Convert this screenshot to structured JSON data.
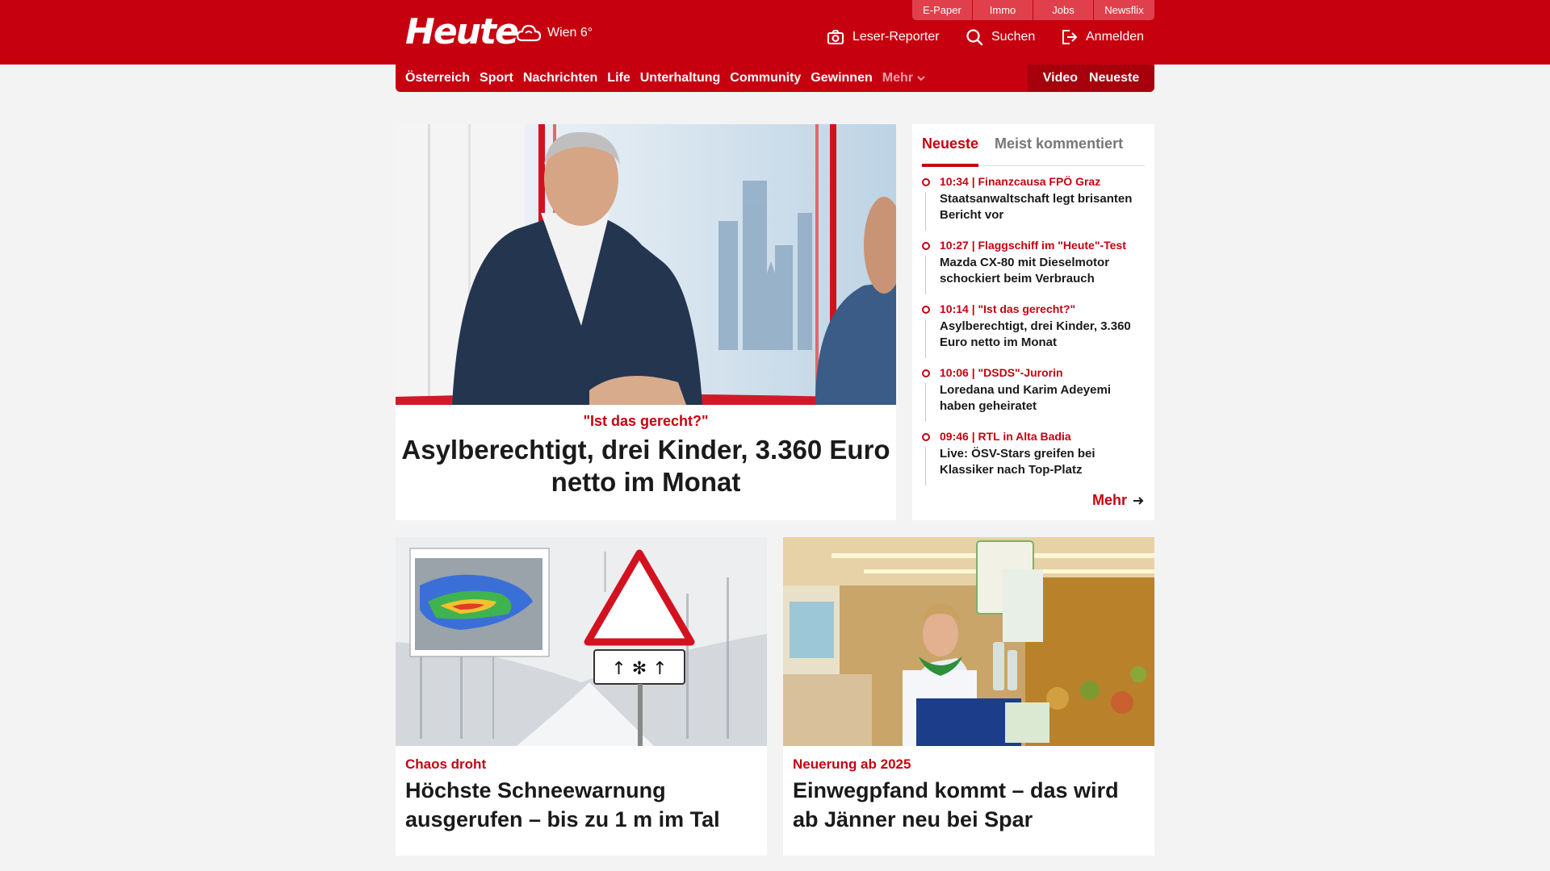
{
  "header": {
    "logo": "Heute",
    "weather": "Wien 6°",
    "service_tabs": [
      "E-Paper",
      "Immo",
      "Jobs",
      "Newsflix"
    ],
    "reporter_label": "Leser-Reporter",
    "search_label": "Suchen",
    "login_label": "Anmelden"
  },
  "nav": {
    "items": [
      "Österreich",
      "Sport",
      "Nachrichten",
      "Life",
      "Unterhaltung",
      "Community",
      "Gewinnen"
    ],
    "more_label": "Mehr",
    "video_label": "Video",
    "latest_label": "Neueste"
  },
  "hero": {
    "kicker": "\"Ist das gerecht?\"",
    "title": "Asylberechtigt, drei Kinder, 3.360 Euro netto im Monat"
  },
  "sidebar": {
    "tabs": [
      "Neueste",
      "Meist kommentiert"
    ],
    "items": [
      {
        "meta": "10:34 | Finanzcausa FPÖ Graz",
        "title": "Staatsanwaltschaft legt brisanten Bericht vor"
      },
      {
        "meta": "10:27 | Flaggschiff im \"Heute\"-Test",
        "title": "Mazda CX-80 mit Dieselmotor schockiert beim Verbrauch"
      },
      {
        "meta": "10:14 | \"Ist das gerecht?\"",
        "title": "Asylberechtigt, drei Kinder, 3.360 Euro netto im Monat"
      },
      {
        "meta": "10:06 | \"DSDS\"-Jurorin",
        "title": "Loredana und Karim Adeyemi haben geheiratet"
      },
      {
        "meta": "09:46 | RTL in Alta Badia",
        "title": "Live: ÖSV-Stars greifen bei Klassiker nach Top-Platz"
      }
    ],
    "more_label": "Mehr"
  },
  "cards": [
    {
      "kicker": "Chaos droht",
      "title": "Höchste Schneewarnung ausgerufen – bis zu 1 m im Tal"
    },
    {
      "kicker": "Neuerung ab 2025",
      "title": "Einwegpfand kommt – das wird ab Jänner neu bei Spar"
    }
  ],
  "colors": {
    "brand": "#c70010",
    "background": "#f3f3f3"
  }
}
